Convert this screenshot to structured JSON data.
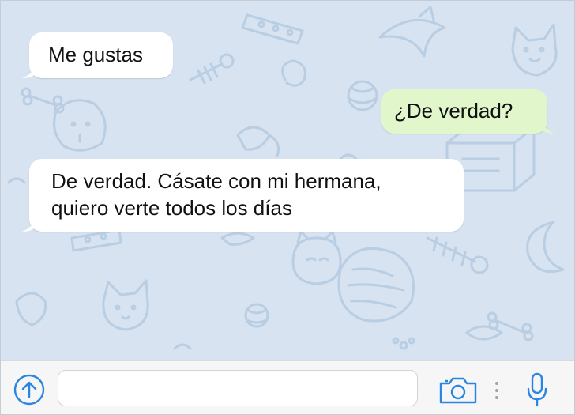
{
  "colors": {
    "wallpaper": "#d7e3f0",
    "doodle_stroke": "#b9cde3",
    "incoming_bubble": "#ffffff",
    "outgoing_bubble": "#e1f7cb",
    "accent_blue": "#2a86e0",
    "input_bar": "#f6f6f6"
  },
  "messages": [
    {
      "direction": "incoming",
      "lines": [
        "Me gustas"
      ]
    },
    {
      "direction": "outgoing",
      "lines": [
        "¿De verdad?"
      ]
    },
    {
      "direction": "incoming",
      "lines": [
        "De verdad. Cásate con mi hermana,",
        "quiero verte todos los días"
      ]
    }
  ],
  "input_bar": {
    "attach_icon": "arrow-up-circle-icon",
    "message_value": "",
    "message_placeholder": "",
    "camera_icon": "camera-icon",
    "more_icon": "vertical-dots-icon",
    "mic_icon": "microphone-icon"
  }
}
